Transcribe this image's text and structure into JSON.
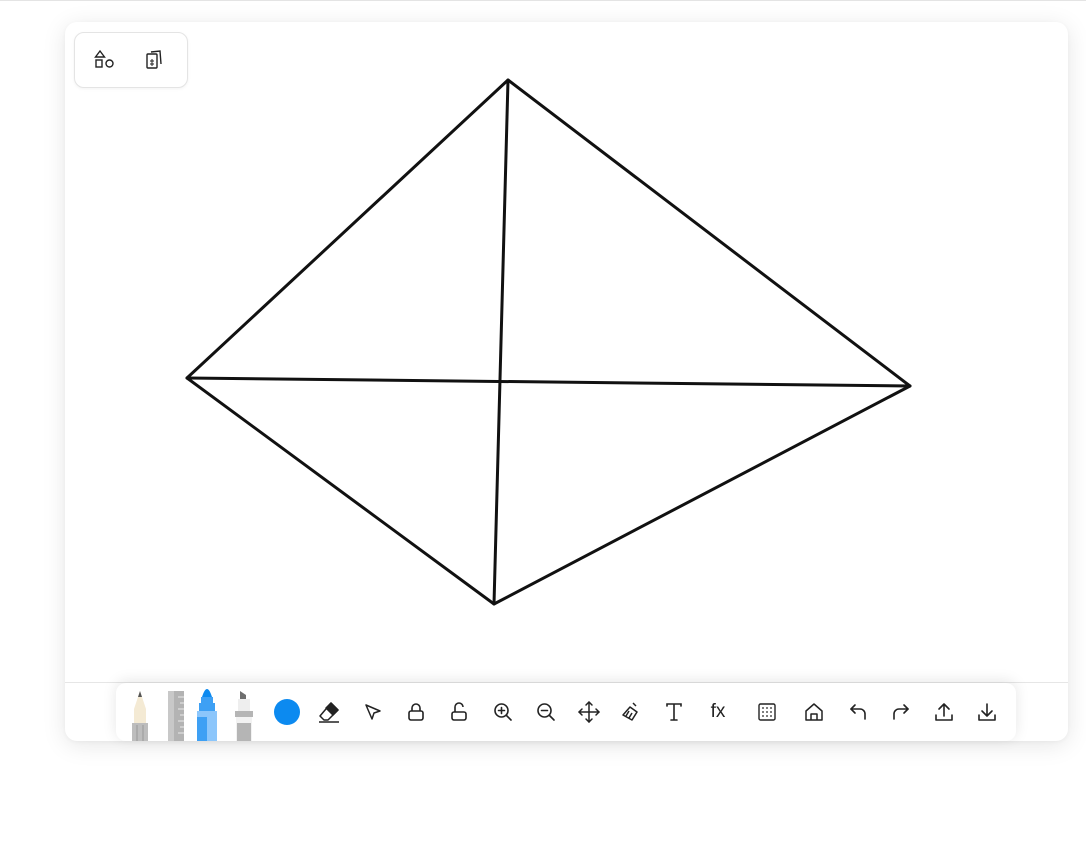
{
  "top_tools": {
    "shapes_icon": "shapes-icon",
    "templates_icon": "templates-icon"
  },
  "toolbar": {
    "fx_label": "fx",
    "pen_color": "#0c8af0",
    "tools": [
      "pencil-tool",
      "ruler-tool",
      "marker-tool",
      "highlighter-tool",
      "color-picker",
      "eraser-tool",
      "select-tool",
      "lock-tool",
      "unlock-tool",
      "zoom-in-tool",
      "zoom-out-tool",
      "pan-tool",
      "clear-tool",
      "text-tool",
      "formula-tool",
      "grid-tool",
      "home-tool",
      "undo-tool",
      "redo-tool",
      "export-tool",
      "import-tool"
    ]
  },
  "drawing": {
    "stroke_color": "#111111",
    "shape": "quadrilateral with both diagonals"
  }
}
